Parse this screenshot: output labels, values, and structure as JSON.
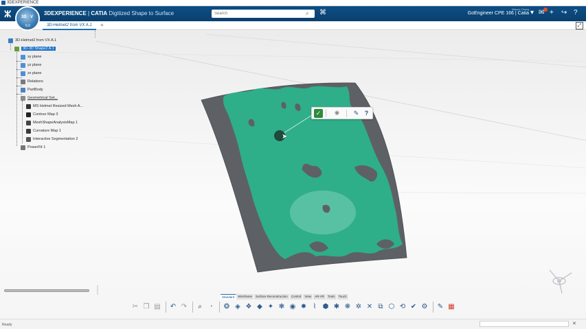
{
  "window": {
    "title": "3DEXPERIENCE"
  },
  "header": {
    "brand_3d": "3DEXPERIENCE",
    "brand_sep": " | ",
    "brand_catia": "CATIA",
    "brand_app": " Digitized Shape to Surface",
    "compass_3d": "3D",
    "compass_v": "V",
    "compass_version": "6.0",
    "search_placeholder": "Search",
    "user_name": "Mason Cheng",
    "user_context": "GoEngineer CPE 166 | Catia"
  },
  "tabs": {
    "active_label": "3D-Helmet2 from VX A.1"
  },
  "tree": {
    "nodes": [
      {
        "label": "3D-Helmet2 from VX A.1",
        "icon": "product-icon"
      },
      {
        "label": "3D-3D Shape2 A.1",
        "icon": "part-icon",
        "selected": true
      },
      {
        "label": "xy plane",
        "icon": "plane-icon"
      },
      {
        "label": "yz plane",
        "icon": "plane-icon"
      },
      {
        "label": "zx plane",
        "icon": "plane-icon"
      },
      {
        "label": "Relations",
        "icon": "relations-icon"
      },
      {
        "label": "PartBody",
        "icon": "body-icon"
      },
      {
        "label": "Geometrical Set...",
        "icon": "geoset-icon",
        "underline": true
      },
      {
        "label": "MS Helmet Resized Mesh A...",
        "icon": "mesh-icon"
      },
      {
        "label": "Contour Map 3",
        "icon": "contour-icon"
      },
      {
        "label": "MeshShapeAnalysisMap 1",
        "icon": "analysis-icon"
      },
      {
        "label": "Curvature Map 1",
        "icon": "curvature-icon"
      },
      {
        "label": "Interactive Segmentation 2",
        "icon": "segmentation-icon"
      },
      {
        "label": "PowerFit 1",
        "icon": "powerfit-icon"
      }
    ]
  },
  "context_toolbar": {
    "check_icon": "check-icon",
    "compass_icon": "compass-icon",
    "brush_icon": "brush-icon",
    "help_icon": "help-icon"
  },
  "ribbon": {
    "tabs": [
      "Standard",
      "Wireframe",
      "Surface Reconstruction",
      "Control",
      "View",
      "AR-VR",
      "Tools",
      "Touch"
    ],
    "active_tab": "Standard"
  },
  "status": {
    "text": "Ready"
  },
  "colors": {
    "header_bg": "#0a3f6e",
    "accent": "#1b72c6",
    "mesh_green": "#2fae8a",
    "mesh_gray": "#5d6166"
  }
}
